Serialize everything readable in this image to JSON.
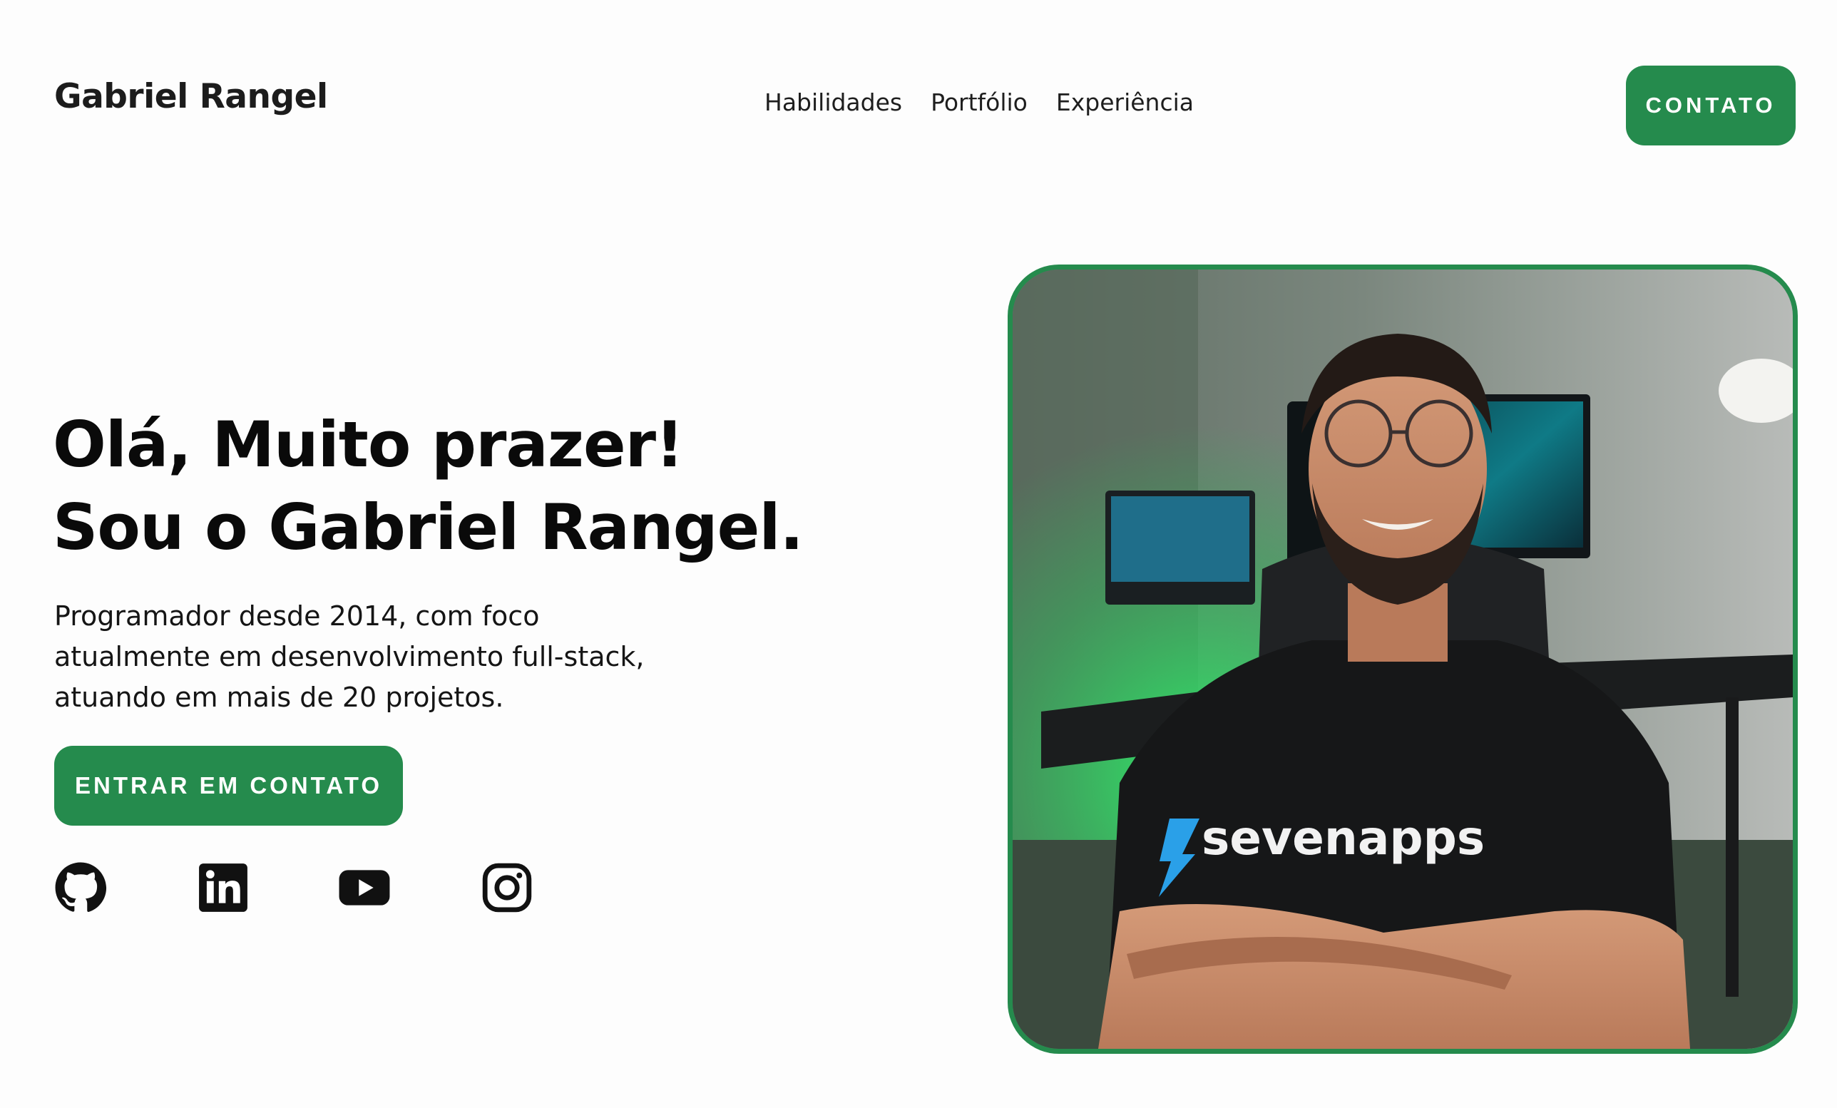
{
  "header": {
    "brand": "Gabriel Rangel",
    "nav": [
      "Habilidades",
      "Portfólio",
      "Experiência"
    ],
    "contact_button": "CONTATO"
  },
  "hero": {
    "headline_line1": "Olá, Muito prazer!",
    "headline_line2": "Sou o Gabriel Rangel.",
    "bio_line1": "Programador desde 2014, com foco",
    "bio_line2": "atualmente em desenvolvimento full-stack,",
    "bio_line3": "atuando em mais de 20 projetos.",
    "cta_button": "ENTRAR EM CONTATO"
  },
  "social_icons": [
    "github-icon",
    "linkedin-icon",
    "youtube-icon",
    "instagram-icon"
  ],
  "photo": {
    "shirt_text": "sevenapps"
  },
  "colors": {
    "accent": "#258b4d",
    "text": "#111111",
    "background": "#fdfdfd"
  }
}
